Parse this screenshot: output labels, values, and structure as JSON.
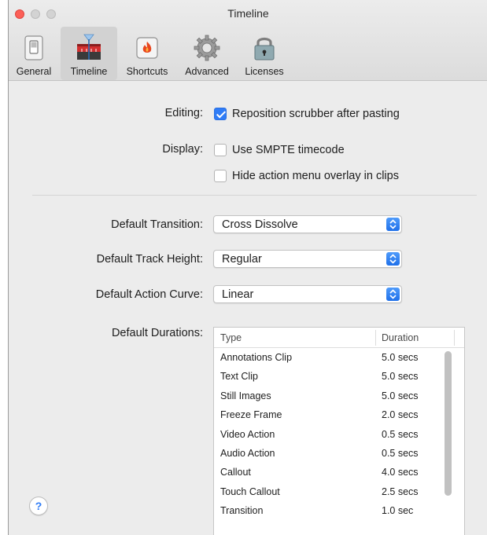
{
  "window": {
    "title": "Timeline"
  },
  "toolbar": {
    "items": [
      {
        "label": "General",
        "icon": "switch-icon"
      },
      {
        "label": "Timeline",
        "icon": "timeline-icon",
        "selected": true
      },
      {
        "label": "Shortcuts",
        "icon": "flame-icon"
      },
      {
        "label": "Advanced",
        "icon": "gear-icon"
      },
      {
        "label": "Licenses",
        "icon": "lock-icon"
      }
    ]
  },
  "editing": {
    "label": "Editing:",
    "reposition_scrubber": {
      "label": "Reposition scrubber after pasting",
      "checked": true
    }
  },
  "display": {
    "label": "Display:",
    "smpte": {
      "label": "Use SMPTE timecode",
      "checked": false
    },
    "hide_action_menu": {
      "label": "Hide action menu overlay in clips",
      "checked": false
    }
  },
  "default_transition": {
    "label": "Default Transition:",
    "value": "Cross Dissolve"
  },
  "default_track_height": {
    "label": "Default Track Height:",
    "value": "Regular"
  },
  "default_action_curve": {
    "label": "Default Action Curve:",
    "value": "Linear"
  },
  "default_durations": {
    "label": "Default Durations:",
    "columns": {
      "type": "Type",
      "duration": "Duration"
    },
    "rows": [
      {
        "type": "Annotations Clip",
        "duration": "5.0 secs"
      },
      {
        "type": "Text Clip",
        "duration": "5.0 secs"
      },
      {
        "type": "Still Images",
        "duration": "5.0 secs"
      },
      {
        "type": "Freeze Frame",
        "duration": "2.0 secs"
      },
      {
        "type": "Video Action",
        "duration": "0.5 secs"
      },
      {
        "type": "Audio Action",
        "duration": "0.5 secs"
      },
      {
        "type": "Callout",
        "duration": "4.0 secs"
      },
      {
        "type": "Touch Callout",
        "duration": "2.5 secs"
      },
      {
        "type": "Transition",
        "duration": "1.0 sec"
      }
    ]
  },
  "help": {
    "label": "?"
  },
  "colors": {
    "accent": "#2f7cf6",
    "close": "#fc5f57",
    "flame": "#e8461e"
  }
}
